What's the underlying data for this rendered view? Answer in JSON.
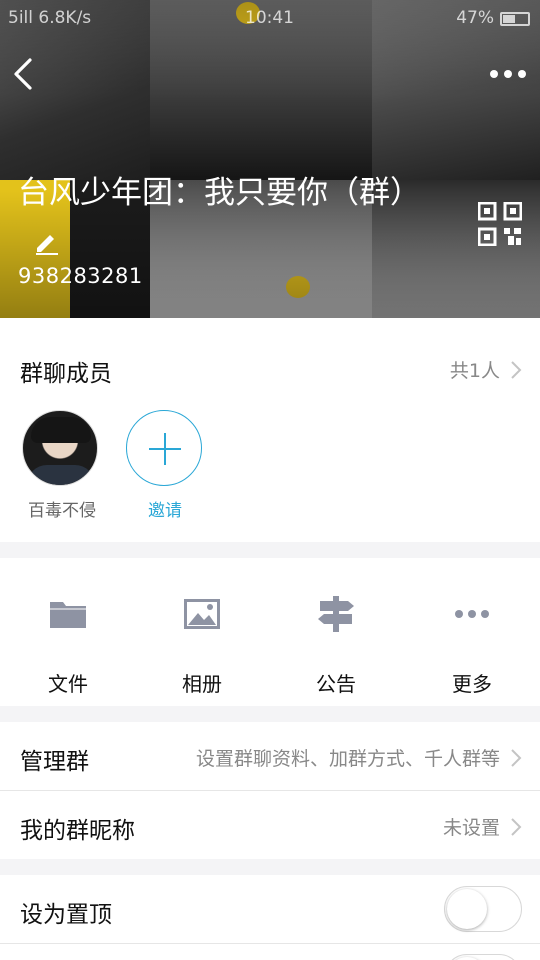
{
  "statusbar": {
    "left": "5ill 6.8K/s",
    "time": "10:41",
    "battery": "47%"
  },
  "header": {
    "title": "台风少年团：我只要你（群）",
    "group_id": "938283281"
  },
  "members_section": {
    "title": "群聊成员",
    "count": "共1人",
    "members": [
      {
        "name": "百毒不侵"
      }
    ],
    "invite_label": "邀请"
  },
  "tools": [
    {
      "label": "文件",
      "icon": "folder-icon"
    },
    {
      "label": "相册",
      "icon": "image-icon"
    },
    {
      "label": "公告",
      "icon": "signpost-icon"
    },
    {
      "label": "更多",
      "icon": "more-dots-icon"
    }
  ],
  "settings": {
    "manage": {
      "label": "管理群",
      "value": "设置群聊资料、加群方式、千人群等"
    },
    "nickname": {
      "label": "我的群昵称",
      "value": "未设置"
    },
    "pin_top": {
      "label": "设为置顶",
      "on": false
    }
  },
  "colors": {
    "accent": "#2aa7d6",
    "icon_gray": "#8e93a3",
    "background": "#f4f4f6"
  }
}
